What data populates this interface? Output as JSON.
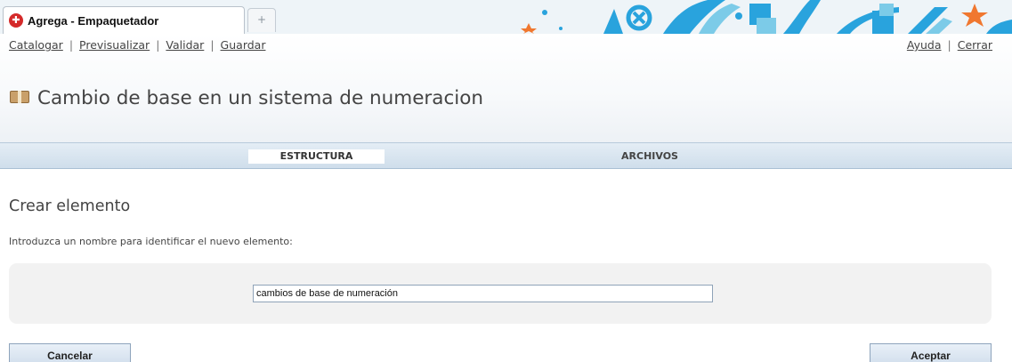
{
  "browser": {
    "tab_title": "Agrega - Empaquetador",
    "tab_icon": "red-compass-icon",
    "new_tab_symbol": "+"
  },
  "toplinks": {
    "left": [
      "Catalogar",
      "Previsualizar",
      "Validar",
      "Guardar"
    ],
    "right": [
      "Ayuda",
      "Cerrar"
    ],
    "separator": "|"
  },
  "page": {
    "title": "Cambio de base en un sistema de numeracion",
    "title_icon": "package-icon"
  },
  "tabs": {
    "structure": "ESTRUCTURA",
    "files": "ARCHIVOS"
  },
  "form": {
    "section_title": "Crear elemento",
    "instructions": "Introduzca un nombre para identificar el nuevo elemento:",
    "name_value": "cambios de base de numeración"
  },
  "buttons": {
    "cancel": "Cancelar",
    "accept": "Aceptar"
  },
  "colors": {
    "tab_bar": "#d6e3ee",
    "panel": "#f2f2f2",
    "accent_blue": "#29a3dd",
    "accent_orange": "#f0772f"
  }
}
